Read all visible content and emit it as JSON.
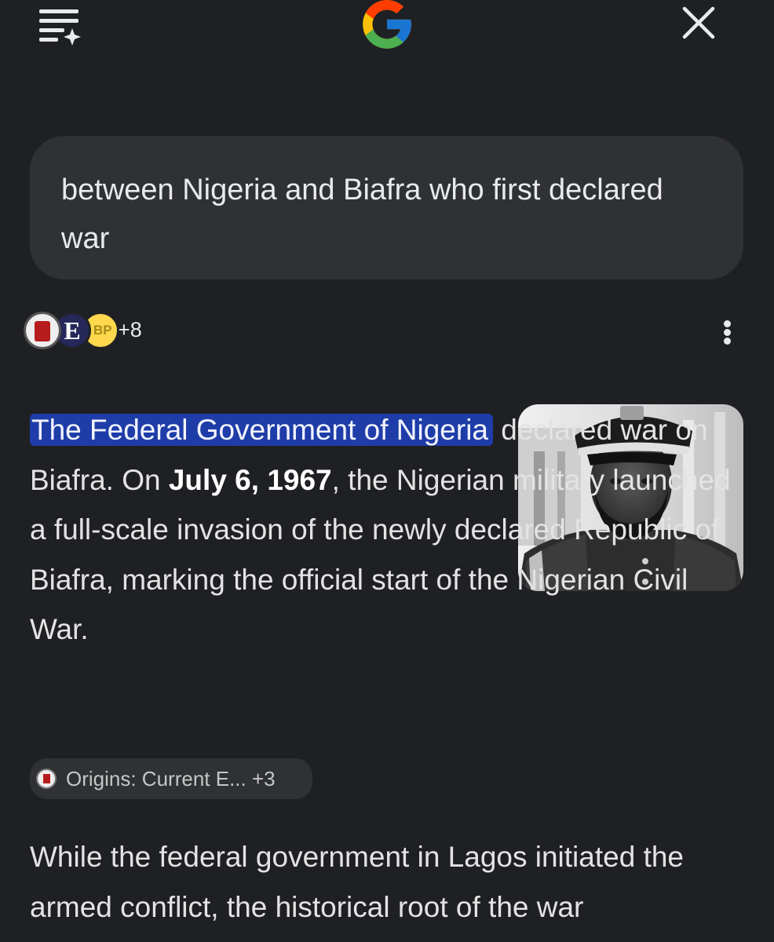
{
  "colors": {
    "background": "#1f2024",
    "bubble": "#303134",
    "highlight": "#1f3da8"
  },
  "header": {
    "menu_icon": "sparkle-list-icon",
    "logo": "google-g-logo",
    "close_icon": "close-icon"
  },
  "query": {
    "text": "between Nigeria and Biafra who first declared war"
  },
  "sources": {
    "icons": [
      "origins-favicon",
      "e-favicon",
      "bp-favicon"
    ],
    "e_label": "E",
    "bp_label": "BP",
    "more_count": "+8"
  },
  "more_options_icon": "more-vert-icon",
  "answer": {
    "highlight": "The Federal Government of Nigeria",
    "text1": " declared war on Biafra. On ",
    "date": "July 6, 1967",
    "text2": ", the Nigerian military launched a full-scale invasion of the newly declared Republic of Biafra, marking the official start of the Nigerian Civil War."
  },
  "image": {
    "icon": "military-officer-portrait"
  },
  "citation_chip": {
    "label": "Origins: Current E... +3"
  },
  "paragraph2": {
    "text": "While the federal government in Lagos initiated the armed conflict, the historical root of the war"
  }
}
